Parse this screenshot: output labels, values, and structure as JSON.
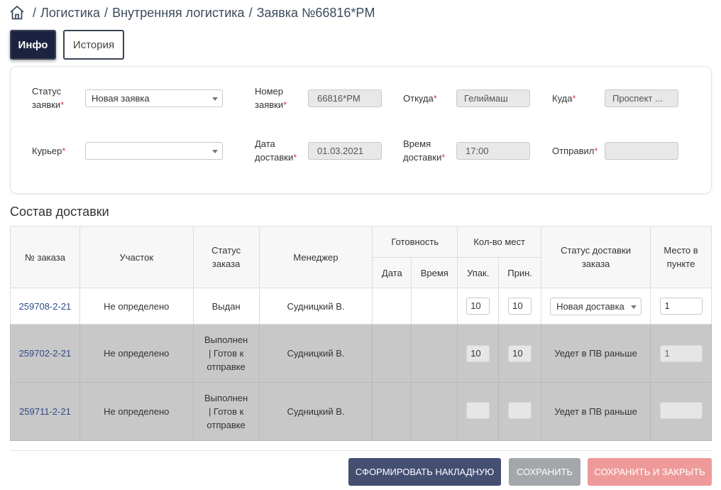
{
  "breadcrumb": {
    "items": [
      "Логистика",
      "Внутренняя логистика",
      "Заявка №66816*PM"
    ],
    "separator": "/"
  },
  "tabs": [
    {
      "label": "Инфо",
      "active": true
    },
    {
      "label": "История",
      "active": false
    }
  ],
  "form": {
    "status": {
      "label1": "Статус",
      "label2": "заявки",
      "value": "Новая заявка"
    },
    "number": {
      "label1": "Номер",
      "label2": "заявки",
      "value": "66816*PM"
    },
    "from": {
      "label": "Откуда",
      "value": "Гелиймаш"
    },
    "to": {
      "label": "Куда",
      "value": "Проспект ..."
    },
    "courier": {
      "label": "Курьер",
      "value": ""
    },
    "delivery_date": {
      "label1": "Дата",
      "label2": "доставки",
      "value": "01.03.2021"
    },
    "delivery_time": {
      "label1": "Время",
      "label2": "доставки",
      "value": "17:00"
    },
    "sender": {
      "label": "Отправил",
      "value": ""
    },
    "required_mark": "*"
  },
  "section_title": "Состав доставки",
  "table": {
    "headers": {
      "order_no": "№ заказа",
      "area": "Участок",
      "order_status_1": "Статус",
      "order_status_2": "заказа",
      "manager": "Менеджер",
      "readiness": "Готовность",
      "date": "Дата",
      "time": "Время",
      "places": "Кол-во мест",
      "packed": "Упак.",
      "received": "Прин.",
      "delivery_status_1": "Статус доставки",
      "delivery_status_2": "заказа",
      "point_place_1": "Место в",
      "point_place_2": "пункте"
    },
    "rows": [
      {
        "order_no": "259708-2-21",
        "area": "Не определено",
        "status_lines": [
          "Выдан"
        ],
        "manager": "Судницкий В.",
        "date": "",
        "time": "",
        "packed": "10",
        "received": "10",
        "delivery_status": "Новая доставка",
        "delivery_status_select": true,
        "point_place": "1"
      },
      {
        "order_no": "259702-2-21",
        "area": "Не определено",
        "status_lines": [
          "Выполнен",
          "| Готов к",
          "отправке"
        ],
        "manager": "Судницкий В.",
        "date": "",
        "time": "",
        "packed": "10",
        "received": "10",
        "delivery_status": "Уедет в ПВ раньше",
        "delivery_status_select": false,
        "point_place": "1"
      },
      {
        "order_no": "259711-2-21",
        "area": "Не определено",
        "status_lines": [
          "Выполнен",
          "| Готов к",
          "отправке"
        ],
        "manager": "Судницкий В.",
        "date": "",
        "time": "",
        "packed": "",
        "received": "",
        "delivery_status": "Уедет в ПВ раньше",
        "delivery_status_select": false,
        "point_place": ""
      }
    ]
  },
  "buttons": {
    "invoice": "СФОРМИРОВАТЬ НАКЛАДНУЮ",
    "save": "СОХРАНИТЬ",
    "save_close": "СОХРАНИТЬ И ЗАКРЫТЬ"
  },
  "colors": {
    "primary": "#444f72",
    "tab_active": "#1c2340",
    "required": "#e0393e",
    "link": "#2f4a86",
    "row_disabled": "#c8c8c8",
    "save_close": "#ef9a9a"
  }
}
